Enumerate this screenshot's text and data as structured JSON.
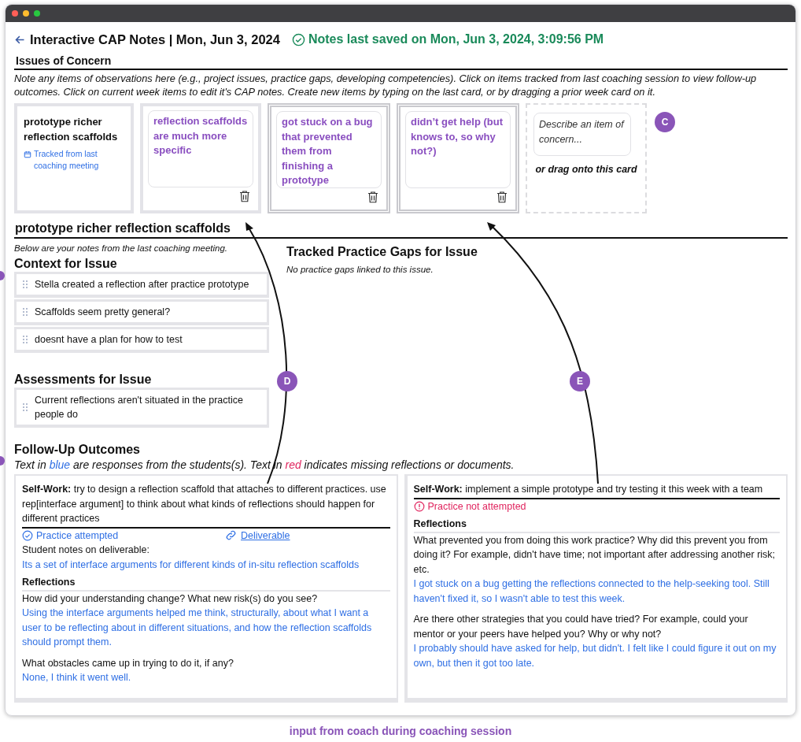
{
  "window": {
    "title": "Interactive CAP Notes | Mon, Jun 3, 2024",
    "save_status": "Notes last saved on Mon, Jun 3, 2024, 3:09:56 PM"
  },
  "issues": {
    "heading": "Issues of Concern",
    "instructions": "Note any items of observations here (e.g., project issues, practice gaps, developing competencies). Click on items tracked from last coaching session to view follow-up outcomes. Click on current week items to edit it's CAP notes. Create new items by typing on the last card, or by dragging a prior week card on it.",
    "cards": [
      {
        "kind": "tracked",
        "text": "prototype richer reflection scaffolds",
        "note": "Tracked from last coaching meeting"
      },
      {
        "kind": "current",
        "text": "reflection scaffolds are much more specific",
        "selected": false
      },
      {
        "kind": "current",
        "text": "got stuck on a bug that prevented them from finishing a prototype",
        "selected": true
      },
      {
        "kind": "current",
        "text": "didn’t get help (but knows to, so why not?)",
        "selected": true
      },
      {
        "kind": "new",
        "placeholder": "Describe an item of concern...",
        "hint": "or drag onto this card"
      }
    ]
  },
  "issue_detail": {
    "title": "prototype richer reflection scaffolds",
    "subtitle": "Below are your notes from the last coaching meeting.",
    "context": {
      "heading": "Context for Issue",
      "items": [
        "Stella created a reflection after practice prototype",
        "Scaffolds seem pretty general?",
        "doesnt have a plan for how to test"
      ]
    },
    "assessments": {
      "heading": "Assessments for Issue",
      "items": [
        "Current reflections aren't situated in the practice people do"
      ]
    },
    "practice_gaps": {
      "heading": "Tracked Practice Gaps for Issue",
      "empty_text": "No practice gaps linked to this issue."
    }
  },
  "follow_up": {
    "heading": "Follow-Up Outcomes",
    "legend": [
      {
        "text": "Text in "
      },
      {
        "text": "blue",
        "color": "#2f6fe4"
      },
      {
        "text": " are responses from the students(s). Text in "
      },
      {
        "text": "red",
        "color": "#e0245e"
      },
      {
        "text": " indicates missing reflections or documents."
      }
    ],
    "outcomes": [
      {
        "label": "Self-Work:",
        "practice": "try to design a reflection scaffold that attaches to different practices. use rep[interface argument] to think about what kinds of reflections should happen for different practices",
        "attempted": true,
        "status": "Practice attempted",
        "deliverable": "Deliverable",
        "notes_label": "Student notes on deliverable:",
        "notes": "Its a set of interface arguments for different kinds of in-situ reflection scaffolds",
        "reflections_heading": "Reflections",
        "reflections": [
          {
            "question": "How did your understanding change? What new risk(s) do you see?",
            "answer": "Using the interface arguments helped me think, structurally, about what I want a user to be reflecting about in different situations, and how the reflection scaffolds should prompt them."
          },
          {
            "question": "What obstacles came up in trying to do it, if any?",
            "answer": "None, I think it went well."
          }
        ]
      },
      {
        "label": "Self-Work:",
        "practice": "implement a simple prototype and try testing it this week with a team",
        "attempted": false,
        "status": "Practice not attempted",
        "reflections_heading": "Reflections",
        "reflections": [
          {
            "question": "What prevented you from doing this work practice? Why did this prevent you from doing it? For example, didn't have time; not important after addressing another risk; etc.",
            "answer": "I got stuck on a bug getting the reflections connected to the help-seeking tool. Still haven't fixed it, so I wasn't able to test this week."
          },
          {
            "question": "Are there other strategies that you could have tried? For example, could your mentor or your peers have helped you? Why or why not?",
            "answer": "I probably should have asked for help, but didn't. I felt like I could figure it out on my own, but then it got too late."
          }
        ]
      }
    ]
  },
  "annotations": {
    "badges": [
      "C",
      "D",
      "E"
    ],
    "caption": "input from coach during coaching session"
  }
}
